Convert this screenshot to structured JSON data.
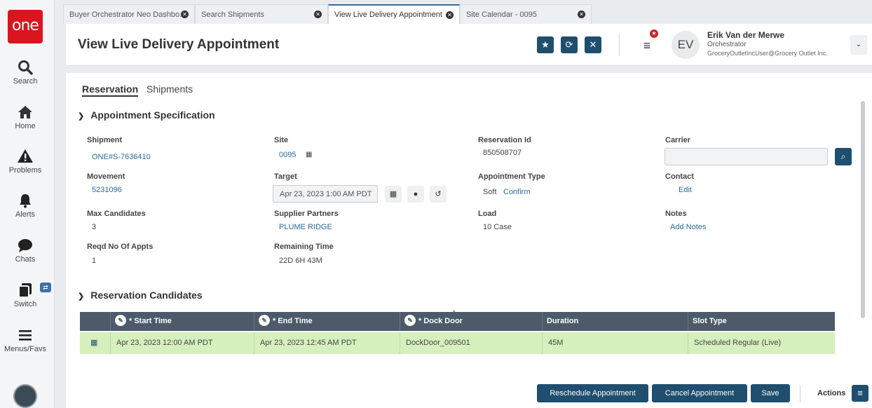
{
  "sidebar": {
    "logo": "one",
    "items": [
      {
        "label": "Search",
        "icon": "search-icon"
      },
      {
        "label": "Home",
        "icon": "home-icon"
      },
      {
        "label": "Problems",
        "icon": "warning-icon"
      },
      {
        "label": "Alerts",
        "icon": "bell-icon"
      },
      {
        "label": "Chats",
        "icon": "chat-icon"
      },
      {
        "label": "Switch",
        "icon": "switch-icon"
      },
      {
        "label": "Menus/Favs",
        "icon": "menu-icon"
      }
    ]
  },
  "tabs": [
    {
      "label": "Buyer Orchestrator Neo Dashbo..."
    },
    {
      "label": "Search Shipments"
    },
    {
      "label": "View Live Delivery Appointment"
    },
    {
      "label": "Site Calendar - 0095"
    }
  ],
  "header": {
    "title": "View Live Delivery Appointment",
    "user": {
      "initials": "EV",
      "name": "Erik Van der Merwe",
      "role": "Orchestrator",
      "email": "GroceryOutletIncUser@Grocery Outlet Inc."
    }
  },
  "subtabs": [
    "Reservation",
    "Shipments"
  ],
  "spec": {
    "heading": "Appointment Specification",
    "shipment_label": "Shipment",
    "shipment_value": "ONE#S-7636410",
    "movement_label": "Movement",
    "movement_value": "5231096",
    "max_candidates_label": "Max Candidates",
    "max_candidates_value": "3",
    "reqd_label": "Reqd No Of Appts",
    "reqd_value": "1",
    "site_label": "Site",
    "site_value": "0095",
    "target_label": "Target",
    "target_value": "Apr 23, 2023 1:00 AM PDT",
    "supplier_label": "Supplier Partners",
    "supplier_value": "PLUME RIDGE",
    "remaining_label": "Remaining Time",
    "remaining_value": "22D 6H 43M",
    "reservation_id_label": "Reservation Id",
    "reservation_id_value": "850508707",
    "appt_type_label": "Appointment Type",
    "appt_type_value": "Soft",
    "appt_type_link": "Confirm",
    "load_label": "Load",
    "load_value": "10 Case",
    "carrier_label": "Carrier",
    "carrier_value": "",
    "contact_label": "Contact",
    "contact_link": "Edit",
    "notes_label": "Notes",
    "notes_link": "Add Notes"
  },
  "candidates": {
    "heading": "Reservation Candidates",
    "columns": [
      "* Start Time",
      "* End Time",
      "* Dock Door",
      "Duration",
      "Slot Type"
    ],
    "rows": [
      {
        "start": "Apr 23, 2023 12:00 AM PDT",
        "end": "Apr 23, 2023 12:45 AM PDT",
        "dock": "DockDoor_009501",
        "duration": "45M",
        "slot": "Scheduled Regular (Live)"
      }
    ]
  },
  "footer": {
    "reschedule": "Reschedule Appointment",
    "cancel": "Cancel Appointment",
    "save": "Save",
    "actions": "Actions"
  },
  "colors": {
    "brand": "#d9151f",
    "primary_button": "#1f4e6e",
    "table_header": "#4d5a69",
    "selected_row": "#d6f0bd",
    "link": "#2b6aa0"
  }
}
